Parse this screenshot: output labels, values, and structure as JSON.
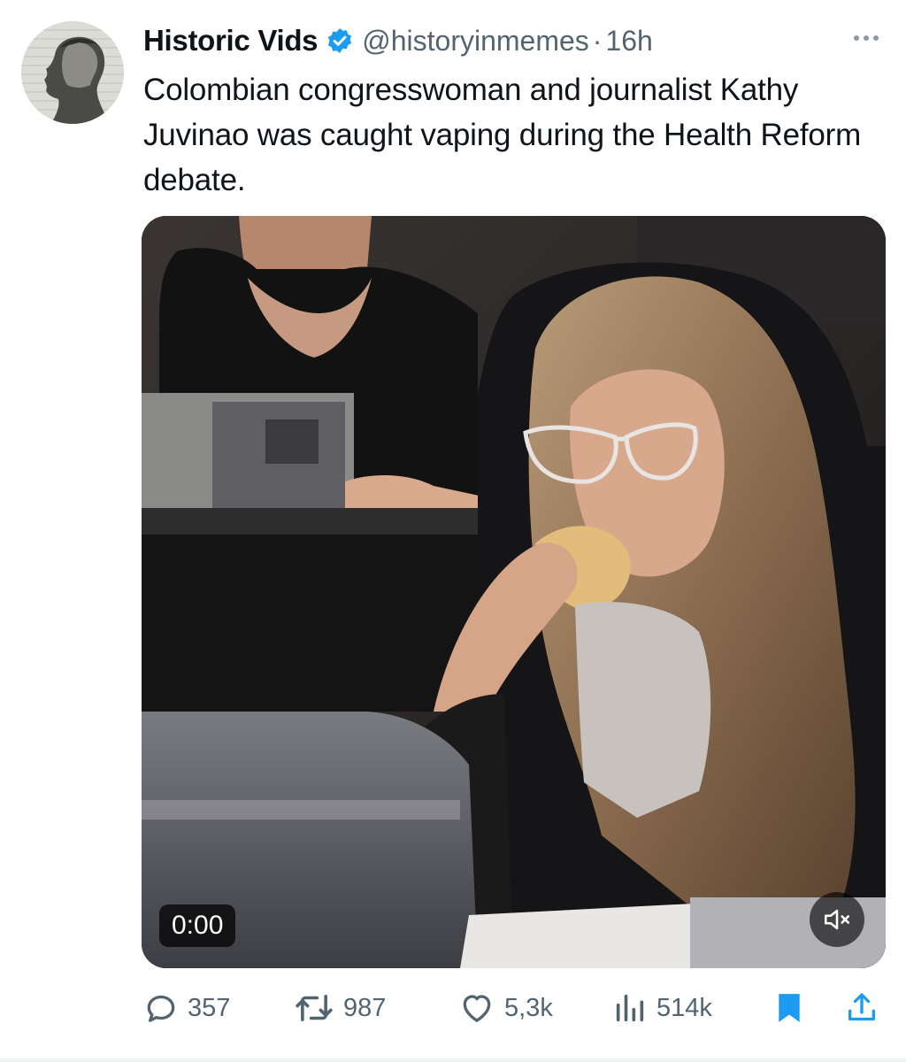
{
  "post": {
    "author_name": "Historic Vids",
    "handle": "@historyinmemes",
    "separator": "·",
    "time": "16h",
    "text": "Colombian congresswoman and journalist Kathy Juvinao was caught vaping during the Health Reform debate."
  },
  "media": {
    "timestamp": "0:00",
    "muted": true
  },
  "actions": {
    "replies": "357",
    "reposts": "987",
    "likes": "5,3k",
    "views": "514k",
    "bookmarked": true
  },
  "colors": {
    "verified_badge": "#1d9bf0",
    "bookmark": "#1d9bf0",
    "secondary_text": "#536471"
  },
  "icons": {
    "more": "more-horizontal-icon",
    "verified": "verified-badge-icon",
    "reply": "reply-icon",
    "repost": "repost-icon",
    "like": "heart-icon",
    "views": "views-bar-chart-icon",
    "bookmark": "bookmark-icon",
    "share": "share-icon",
    "mute": "speaker-muted-icon"
  }
}
